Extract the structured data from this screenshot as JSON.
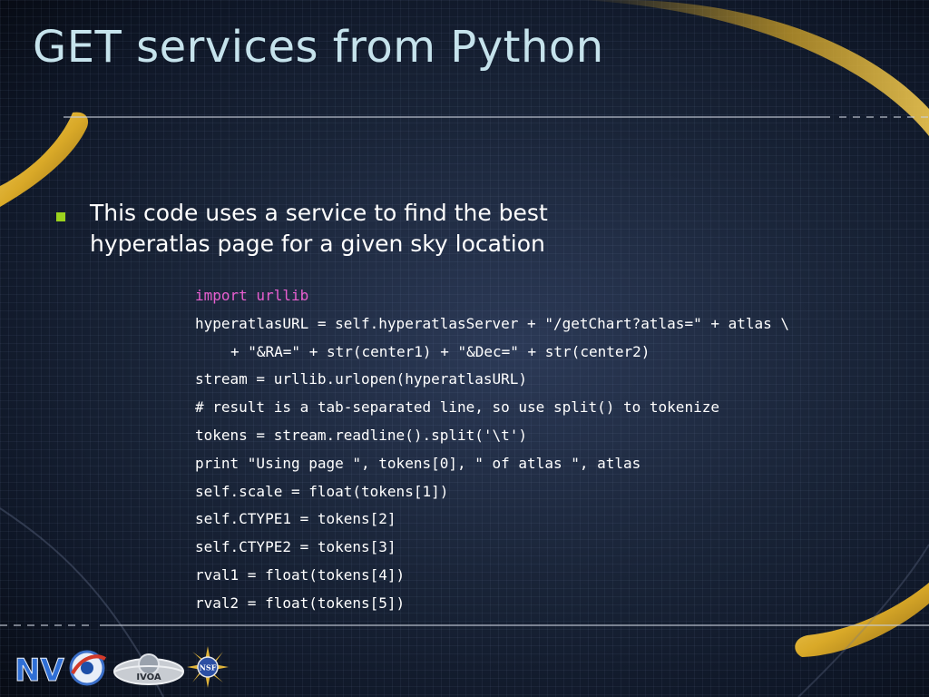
{
  "slide": {
    "title": "GET services from Python",
    "bullet": "This code uses a service to find the best\nhyperatlas page  for a given sky location",
    "code_lines": [
      "import urllib",
      "hyperatlasURL = self.hyperatlasServer + \"/getChart?atlas=\" + atlas \\",
      "+ \"&RA=\" + str(center1) + \"&Dec=\" + str(center2)",
      "stream = urllib.urlopen(hyperatlasURL)",
      "# result is a tab-separated line, so use split() to tokenize",
      "tokens = stream.readline().split('\\t')",
      "print \"Using page \", tokens[0], \" of atlas \", atlas",
      "self.scale = float(tokens[1])",
      "self.CTYPE1 = tokens[2]",
      "self.CTYPE2 = tokens[3]",
      "rval1 = float(tokens[4])",
      "rval2 = float(tokens[5])"
    ]
  },
  "logos": {
    "nvo": "NV",
    "ivoa": "IVOA",
    "nsf": "NSF"
  },
  "colors": {
    "title": "#c6e3ec",
    "bullet_marker": "#9bd21e",
    "keyword": "#e85fd0",
    "swoosh_gold": "#d9a928",
    "code_text": "#ffffff"
  }
}
